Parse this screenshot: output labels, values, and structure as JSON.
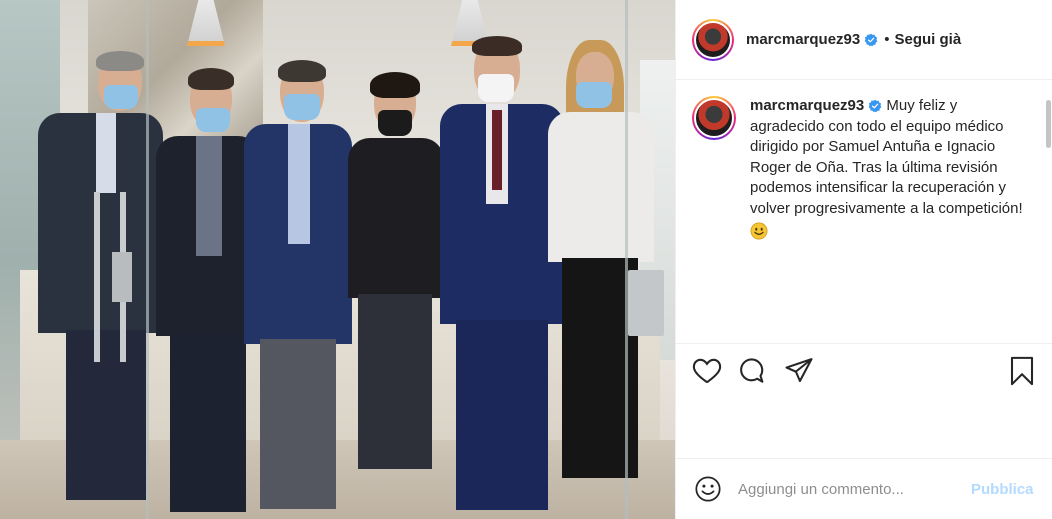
{
  "post": {
    "photo_description_icon": "post-photo",
    "username": "marcmarquez93",
    "verified_icon": "verified-badge-icon",
    "follow_separator": "•",
    "follow_label": "Segui già",
    "caption_username": "marcmarquez93",
    "caption_text": "Muy feliz y agradecido con todo el equipo médico dirigido por Samuel Antuña e Ignacio Roger de Oña. Tras la última revisión podemos intensificar la recuperación y volver progresivamente a la competición!",
    "caption_emoji": "smiling-face-emoji"
  },
  "actions": {
    "like_icon": "heart-icon",
    "comment_icon": "comment-icon",
    "share_icon": "paper-plane-icon",
    "save_icon": "bookmark-icon"
  },
  "comment_bar": {
    "emoji_icon": "smiley-icon",
    "placeholder": "Aggiungi un commento...",
    "publish_label": "Pubblica"
  },
  "colors": {
    "accent_link": "#0095f6",
    "publish_disabled": "#b3dbff",
    "verified_blue": "#3897f0",
    "text": "#262626",
    "muted": "#8e8e8e",
    "border": "#efefef"
  }
}
